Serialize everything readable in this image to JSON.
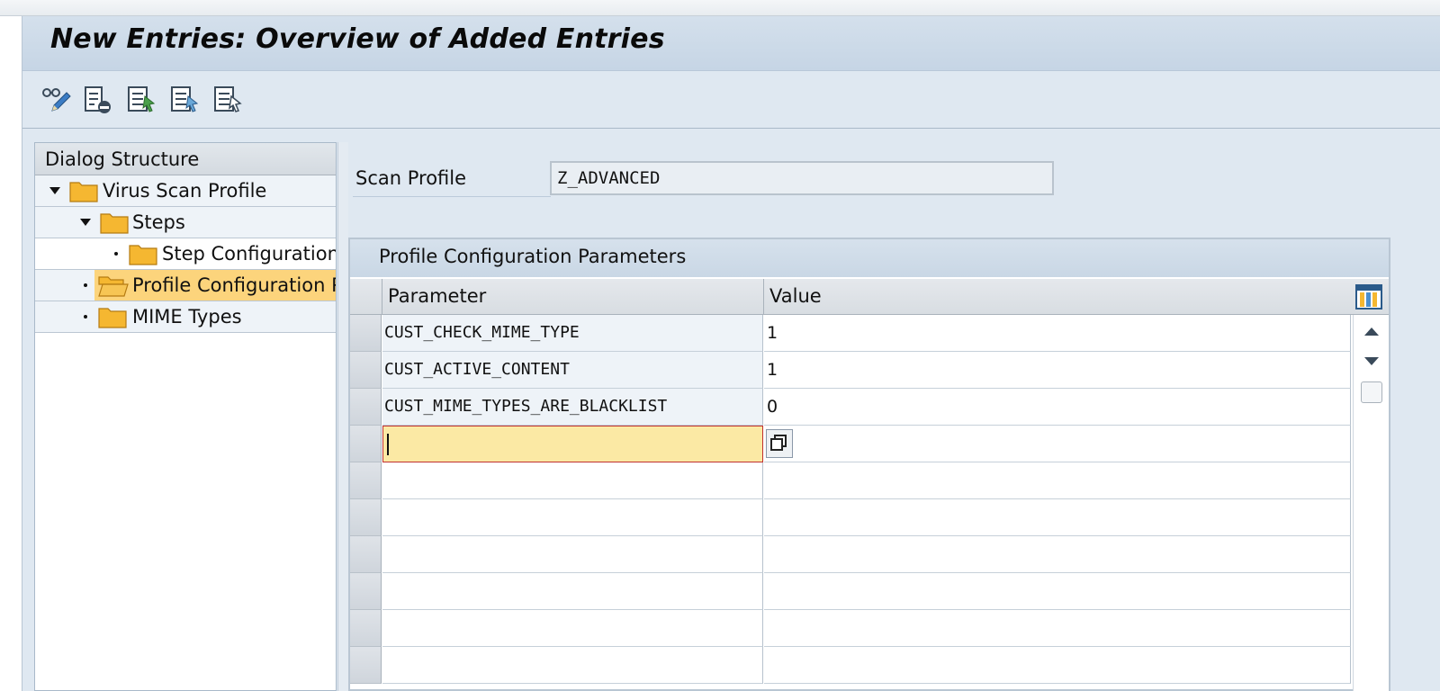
{
  "window": {
    "title": "New Entries: Overview of Added Entries"
  },
  "toolbar": {
    "buttons": [
      {
        "name": "change-display-button",
        "icon": "glasses-pencil-icon"
      },
      {
        "name": "delete-button",
        "icon": "delete-row-icon"
      },
      {
        "name": "select-all-button",
        "icon": "select-all-icon"
      },
      {
        "name": "select-block-button",
        "icon": "select-block-icon"
      },
      {
        "name": "deselect-all-button",
        "icon": "deselect-all-icon"
      }
    ]
  },
  "dialog_structure": {
    "header": "Dialog Structure",
    "items": [
      {
        "label": "Virus Scan Profile",
        "level": 0,
        "expanded": true
      },
      {
        "label": "Steps",
        "level": 1,
        "expanded": true
      },
      {
        "label": "Step Configuration",
        "level": 2,
        "expanded": false
      },
      {
        "label": "Profile Configuration Parameters",
        "level": 1,
        "expanded": false,
        "selected": true
      },
      {
        "label": "MIME Types",
        "level": 1,
        "expanded": false
      }
    ]
  },
  "scan_profile": {
    "label": "Scan Profile",
    "value": "Z_ADVANCED"
  },
  "grid": {
    "title": "Profile Configuration Parameters",
    "columns": [
      "Parameter",
      "Value"
    ],
    "rows": [
      {
        "parameter": "CUST_CHECK_MIME_TYPE",
        "value": "1"
      },
      {
        "parameter": "CUST_ACTIVE_CONTENT",
        "value": "1"
      },
      {
        "parameter": "CUST_MIME_TYPES_ARE_BLACKLIST",
        "value": "0"
      },
      {
        "parameter": "",
        "value": ""
      },
      {
        "parameter": "",
        "value": ""
      },
      {
        "parameter": "",
        "value": ""
      },
      {
        "parameter": "",
        "value": ""
      },
      {
        "parameter": "",
        "value": ""
      },
      {
        "parameter": "",
        "value": ""
      },
      {
        "parameter": "",
        "value": ""
      }
    ]
  },
  "colors": {
    "background": "#dfe8f1",
    "title_bar": "#c8d6e5",
    "selected_tree_item": "#fcd47c",
    "active_cell": "#fbe9a4",
    "folder": "#f5b731"
  }
}
